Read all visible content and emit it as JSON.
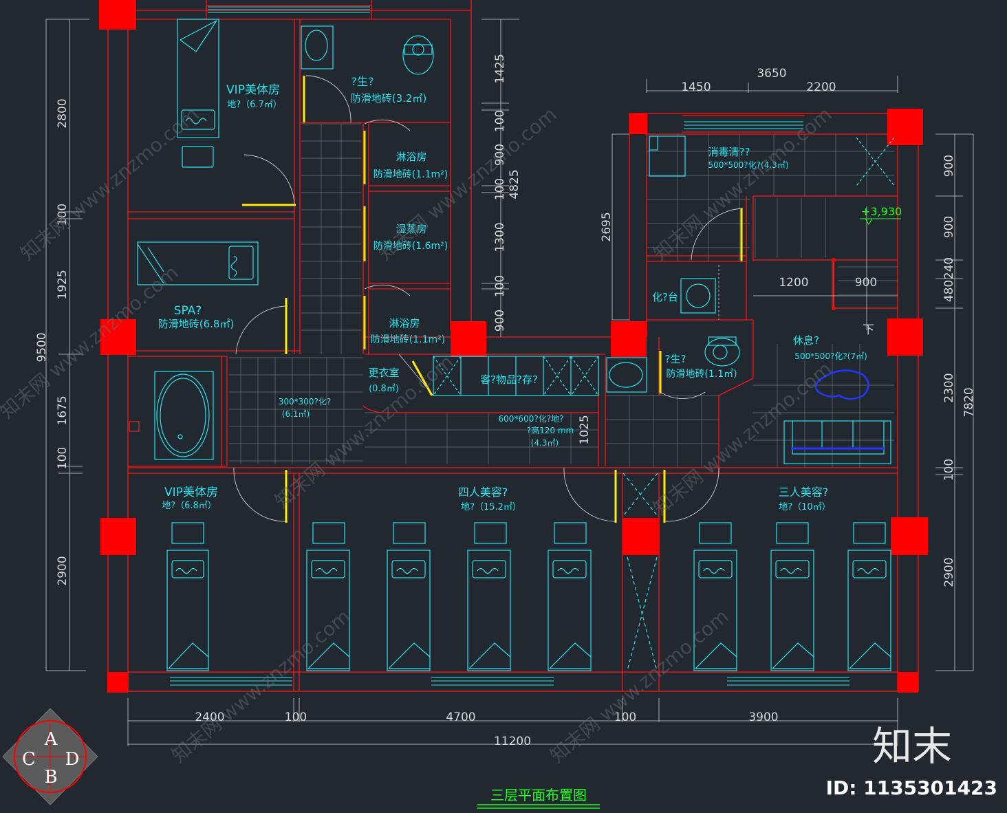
{
  "title": "三层平面布置图",
  "brand": {
    "logo_text": "知末",
    "id_text": "ID: 1135301423",
    "watermark": "知末网 www.znzmo.com",
    "badge_letters": [
      "A",
      "C",
      "D",
      "B"
    ]
  },
  "colors": {
    "background": "#212830",
    "wall": "#ff1414",
    "column": "#ff0000",
    "furniture": "#27e3ee",
    "door_leaf": "#ffee00",
    "title_green": "#22ff22",
    "dimension": "#d8d8d8"
  },
  "rooms": {
    "vip1_name": "VIP美体房",
    "vip1_area": "地?（6.7㎡）",
    "wc1_name": "?生?",
    "wc1_area": "防滑地砖(3.2㎡)",
    "shower1_name": "淋浴房",
    "shower1_area": "防滑地砖(1.1m²)",
    "steam_name": "湿蒸房",
    "steam_area": "防滑地砖(1.6m²)",
    "shower2_name": "淋浴房",
    "shower2_area": "防滑地砖(1.1m²)",
    "spa_name": "SPA?",
    "spa_area": "防滑地砖(6.8㎡)",
    "changing_name": "更衣室",
    "changing_area": "(0.8㎡)",
    "tile300_name": "300*300?化?",
    "tile300_area": "(6.1㎡)",
    "storage_name": "客?物品?存?",
    "tile600_line1": "600*600?化?地?",
    "tile600_line2": "?高120 mm",
    "tile600_area": "(4.3㎡)",
    "disinfect_name": "消毒清??",
    "disinfect_area": "500*500?化?(4.3㎡)",
    "vanity_name": "化?台",
    "wc2_name": "?生?",
    "wc2_area": "防滑地砖(1.1㎡)",
    "rest_name": "休息?",
    "rest_area": "500*500?化?(7㎡)",
    "vip2_name": "VIP美体房",
    "vip2_area": "地?（6.8㎡）",
    "four_name": "四人美容?",
    "four_area": "地?（15.2㎡）",
    "three_name": "三人美容?",
    "three_area": "地?（10㎡）",
    "level_mark": "+3,930",
    "stair_down": "下"
  },
  "dimensions": {
    "left_outer": "9500",
    "left_inner": [
      "2800",
      "100",
      "1925",
      "1675",
      "100",
      "2900"
    ],
    "bottom_inner": [
      "2400",
      "100",
      "4700",
      "100",
      "3900"
    ],
    "bottom_total": "11200",
    "mid_total": "4825",
    "mid_inner": [
      "1425",
      "100",
      "900",
      "100",
      "1300",
      "100",
      "900"
    ],
    "top_right_total": "3650",
    "top_right_inner": [
      "1450",
      "2200"
    ],
    "right_outer": "7820",
    "right_inner": [
      "900",
      "900",
      "240",
      "480",
      "2300",
      "100",
      "2900"
    ],
    "right_mid": "2695",
    "stair_dims": [
      "1200",
      "900"
    ],
    "corridor_dim": "1025"
  }
}
